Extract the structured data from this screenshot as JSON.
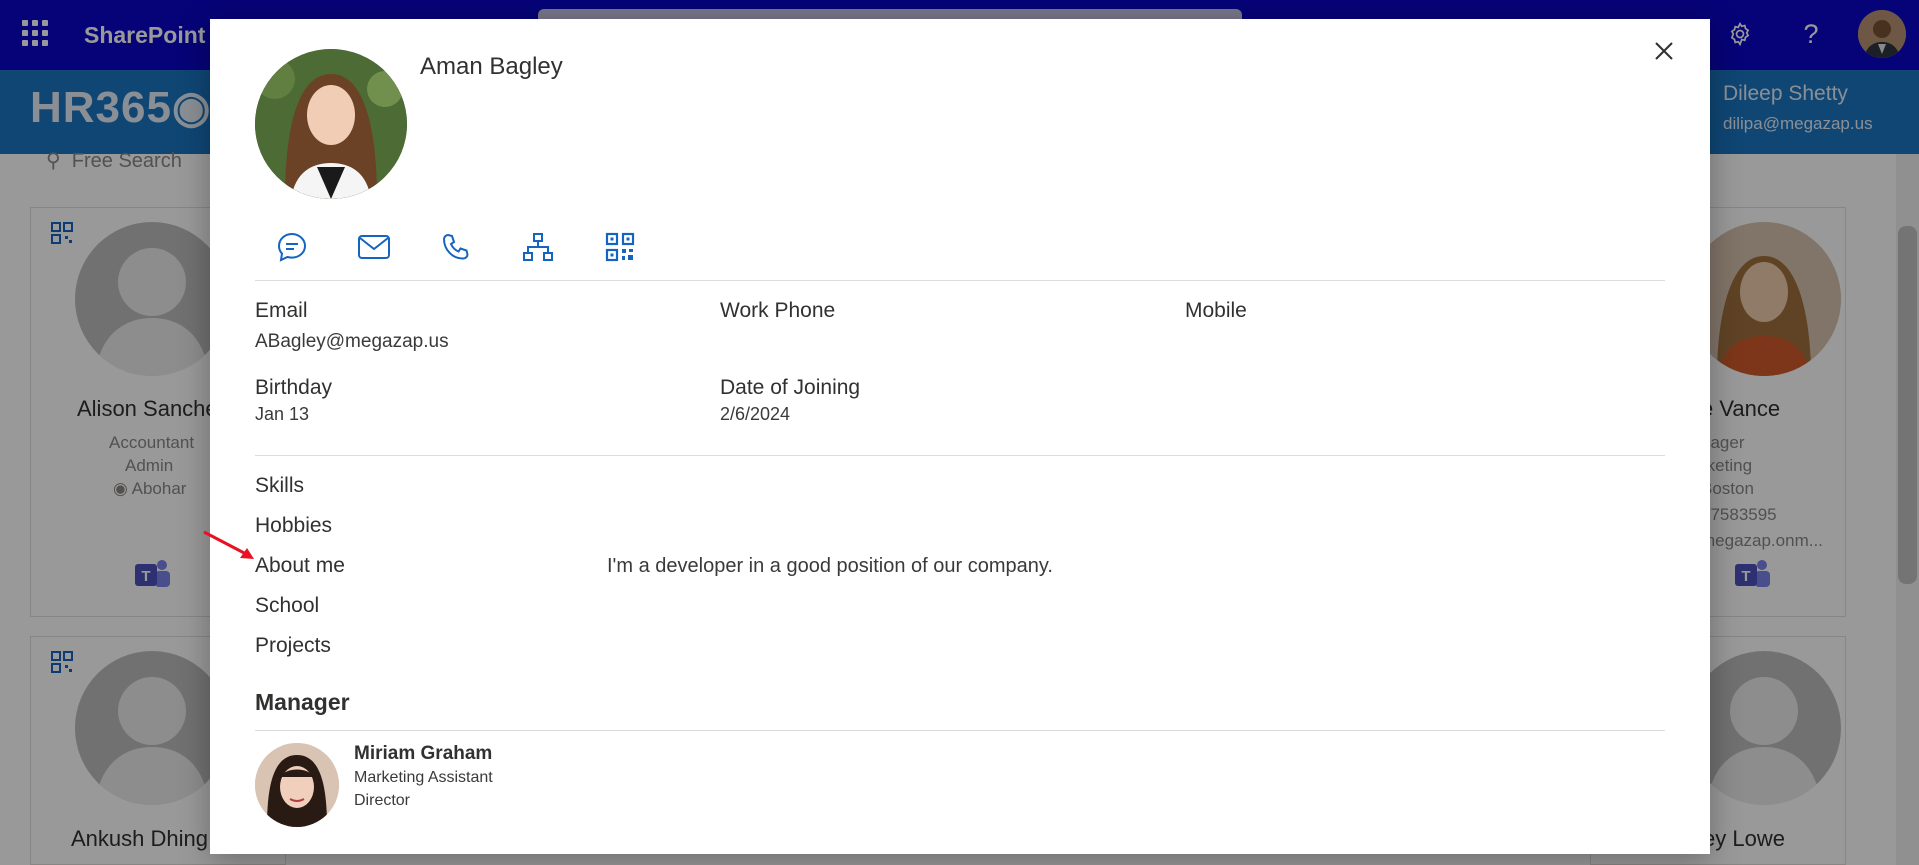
{
  "suite": {
    "title": "SharePoint"
  },
  "app": {
    "logo": "HR365",
    "user_name": "Dileep Shetty",
    "user_email": "dilipa@megazap.us",
    "search_placeholder": "Free Search"
  },
  "background_cards": [
    {
      "name": "Alison Sanche",
      "lines": [
        "Accountant",
        "Admin",
        "Abohar"
      ]
    },
    {
      "name": "e Vance",
      "lines": [
        "nager",
        "rketing",
        "Boston",
        "47583595",
        "megazap.onm..."
      ]
    },
    {
      "name": "Ankush Dhing"
    },
    {
      "name": "ey Lowe"
    }
  ],
  "profile": {
    "name": "Aman Bagley",
    "actions": [
      "chat",
      "email",
      "call",
      "org-chart",
      "qr-code"
    ],
    "fields": {
      "email_label": "Email",
      "email_value": "ABagley@megazap.us",
      "work_phone_label": "Work Phone",
      "mobile_label": "Mobile",
      "birthday_label": "Birthday",
      "birthday_value": "Jan 13",
      "doj_label": "Date of Joining",
      "doj_value": "2/6/2024"
    },
    "details": {
      "skills_label": "Skills",
      "hobbies_label": "Hobbies",
      "about_label": "About me",
      "about_value": "I'm a developer in a good position of our company.",
      "school_label": "School",
      "projects_label": "Projects"
    },
    "manager": {
      "section_title": "Manager",
      "name": "Miriam Graham",
      "title": "Marketing Assistant",
      "role": "Director"
    }
  },
  "colors": {
    "suite_bar": "#0a06c8",
    "hr_bar": "#1a76c2",
    "icon_blue": "#1565c0",
    "annotation_arrow": "#e81123"
  }
}
